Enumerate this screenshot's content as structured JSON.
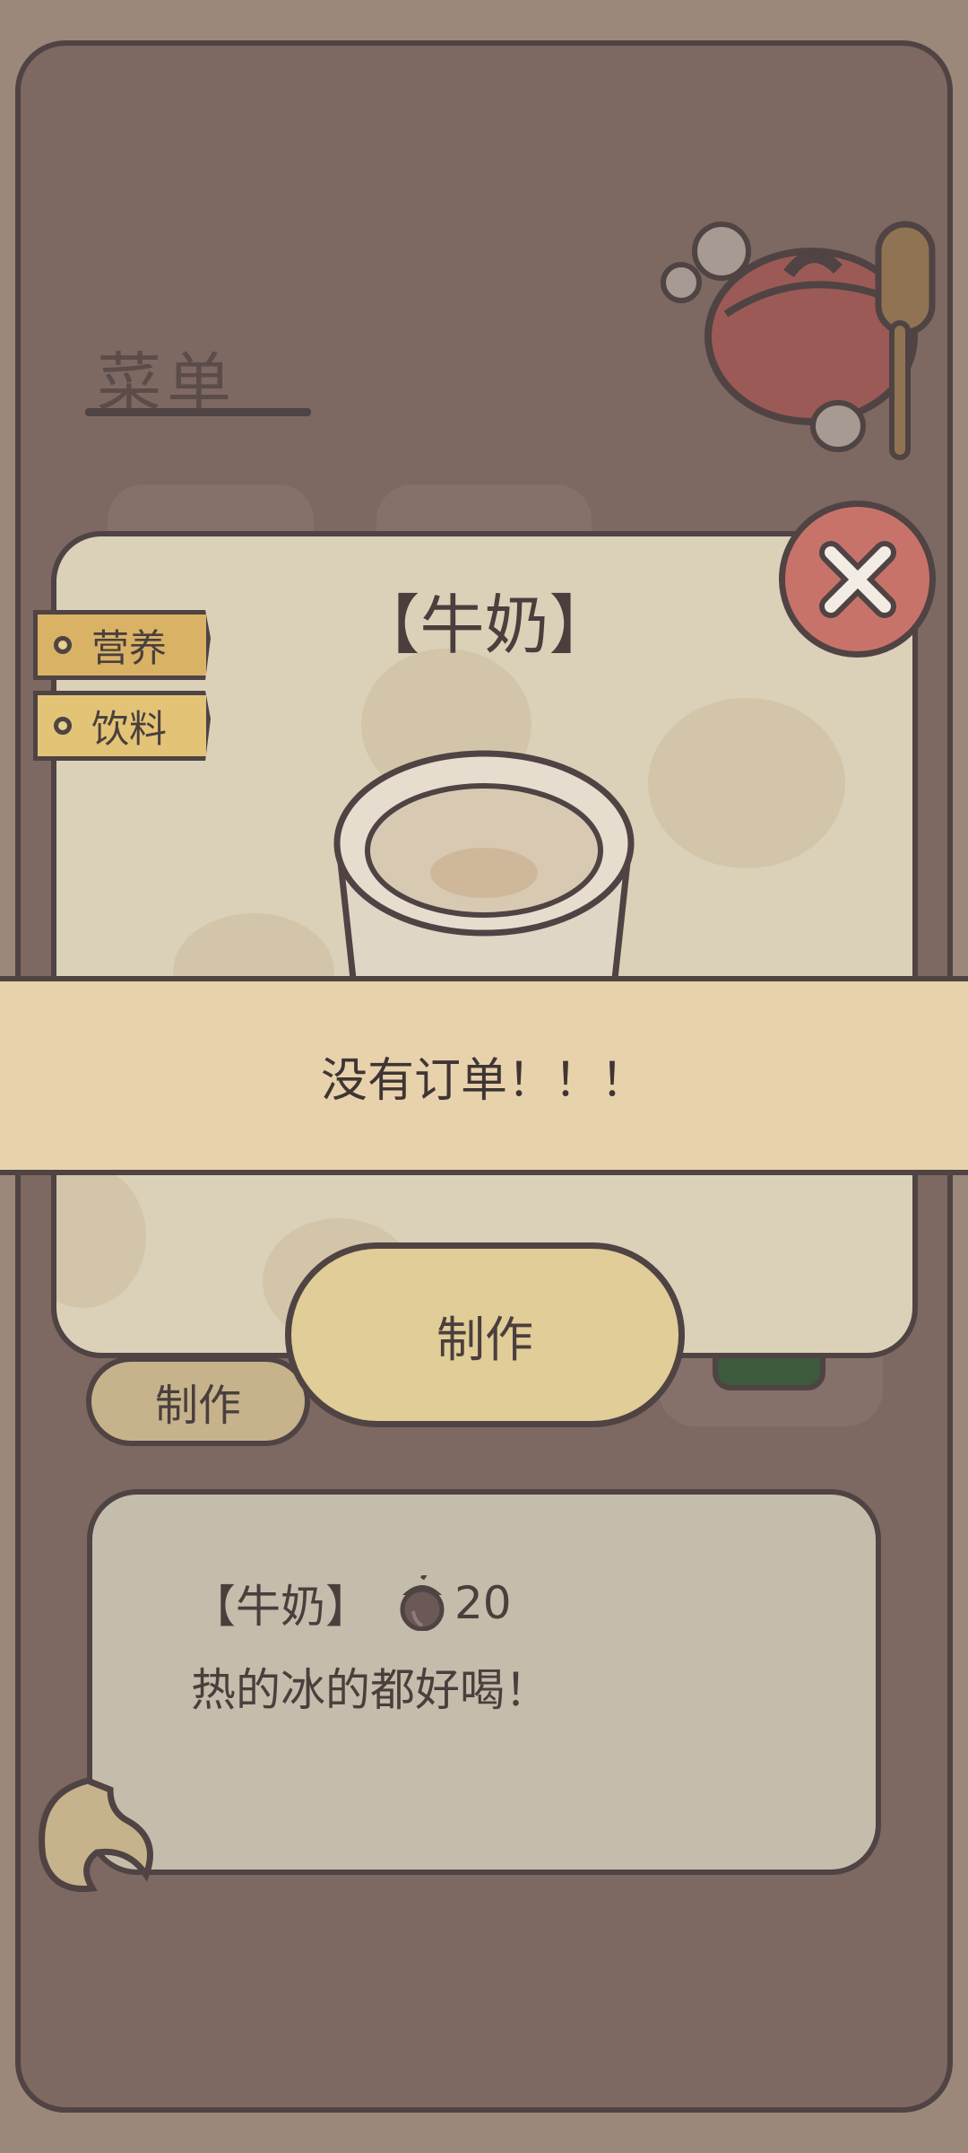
{
  "menu": {
    "title": "菜单"
  },
  "ghost": {
    "make_label": "制作"
  },
  "item": {
    "title": "【牛奶】",
    "tags": [
      "营养",
      "饮料"
    ],
    "make_label": "制作"
  },
  "banner": {
    "text": "没有订单！！！"
  },
  "description": {
    "name": "【牛奶】",
    "price": "20",
    "text": "热的冰的都好喝！"
  },
  "colors": {
    "background": "#9c877b",
    "panel": "#7d6862",
    "card": "#dbd1b9",
    "banner": "#e8d2ab",
    "close_button": "#c8736a",
    "tag": "#d9b266",
    "make_button": "#e0cd97",
    "outline": "#4f4343"
  },
  "icons": [
    "close-icon",
    "acorn-icon",
    "milk-glass-icon",
    "cooking-pot-icon",
    "tail-icon"
  ]
}
